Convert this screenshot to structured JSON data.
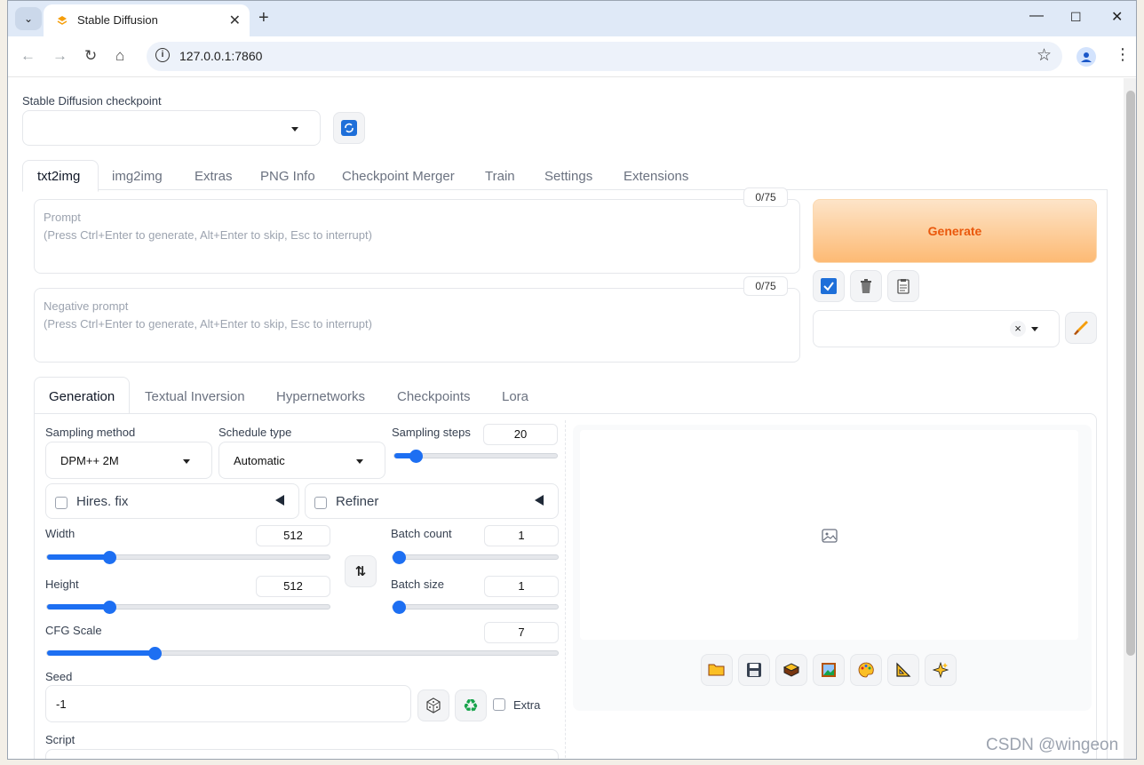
{
  "browser": {
    "tab_title": "Stable Diffusion",
    "url": "127.0.0.1:7860"
  },
  "checkpoint": {
    "label": "Stable Diffusion checkpoint",
    "value": ""
  },
  "main_tabs": [
    "txt2img",
    "img2img",
    "Extras",
    "PNG Info",
    "Checkpoint Merger",
    "Train",
    "Settings",
    "Extensions"
  ],
  "prompt": {
    "label": "Prompt",
    "placeholder": "(Press Ctrl+Enter to generate, Alt+Enter to skip, Esc to interrupt)",
    "counter": "0/75"
  },
  "negative_prompt": {
    "label": "Negative prompt",
    "placeholder": "(Press Ctrl+Enter to generate, Alt+Enter to skip, Esc to interrupt)",
    "counter": "0/75"
  },
  "generate_label": "Generate",
  "styles": {
    "clear_symbol": "×"
  },
  "sub_tabs": [
    "Generation",
    "Textual Inversion",
    "Hypernetworks",
    "Checkpoints",
    "Lora"
  ],
  "sampling": {
    "method_label": "Sampling method",
    "method_value": "DPM++ 2M",
    "schedule_label": "Schedule type",
    "schedule_value": "Automatic",
    "steps_label": "Sampling steps",
    "steps_value": "20",
    "steps_fraction": 0.13
  },
  "hires_label": "Hires. fix",
  "refiner_label": "Refiner",
  "width": {
    "label": "Width",
    "value": "512",
    "fraction": 0.22
  },
  "height": {
    "label": "Height",
    "value": "512",
    "fraction": 0.22
  },
  "batch_count": {
    "label": "Batch count",
    "value": "1",
    "fraction": 0.0
  },
  "batch_size": {
    "label": "Batch size",
    "value": "1",
    "fraction": 0.0
  },
  "cfg": {
    "label": "CFG Scale",
    "value": "7",
    "fraction": 0.21
  },
  "seed": {
    "label": "Seed",
    "value": "-1",
    "extra_label": "Extra"
  },
  "script_label": "Script",
  "watermark": "CSDN @wingeon",
  "colors": {
    "accent": "#1d6ff2",
    "generate_text": "#ea580c"
  }
}
